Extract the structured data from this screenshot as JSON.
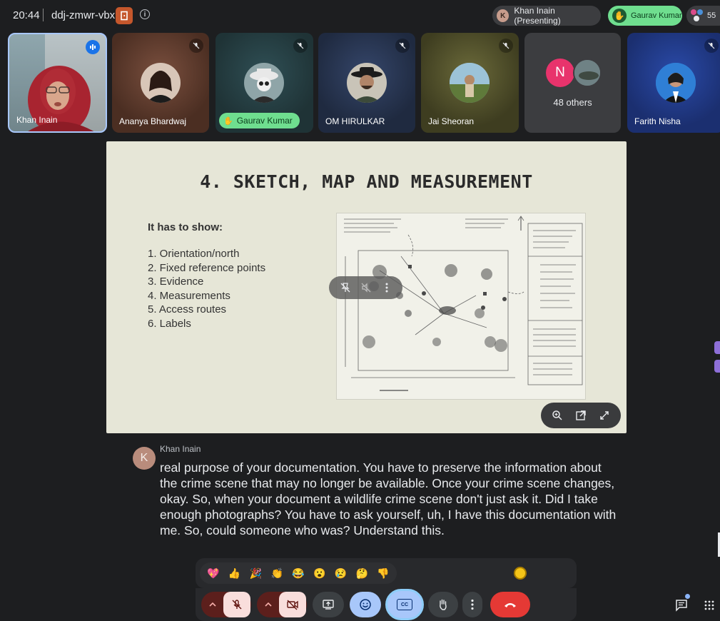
{
  "header": {
    "time": "20:44",
    "meeting_code": "ddj-zmwr-vbx",
    "presenter_initial": "K",
    "presenter_label": "Khan Inain (Presenting)",
    "hand_raised_name": "Gaurav Kumar",
    "participant_count": "55"
  },
  "tiles": [
    {
      "name": "Khan Inain"
    },
    {
      "name": "Ananya Bhardwaj"
    },
    {
      "name": "Gaurav Kumar"
    },
    {
      "name": "OM HIRULKAR"
    },
    {
      "name": "Jai Sheoran"
    },
    {
      "name": "48 others",
      "initial": "N"
    },
    {
      "name": "Farith Nisha"
    }
  ],
  "slide": {
    "title": "4. SKETCH, MAP AND MEASUREMENT",
    "subtitle": "It has to show:",
    "items": [
      "1. Orientation/north",
      "2. Fixed reference points",
      "3. Evidence",
      "4. Measurements",
      "5. Access routes",
      "6. Labels"
    ]
  },
  "caption": {
    "speaker_initial": "K",
    "speaker": "Khan Inain",
    "text": "real purpose of your documentation. You have to preserve the information about the crime scene that may no longer be available. Once your crime scene changes, okay. So, when your document a wildlife crime scene don't just ask it. Did I take enough photographs? You have to ask yourself, uh, I have this documentation with me. So, could someone who was? Understand this."
  },
  "reactions": [
    "💖",
    "👍",
    "🎉",
    "👏",
    "😂",
    "😮",
    "😢",
    "🤔",
    "👎"
  ],
  "controls": {
    "cc_label": "CC"
  },
  "colors": {
    "background": "#1d1e20",
    "hand_pill": "#6fde8f",
    "end_call": "#e53935",
    "mic_off": "#f9dedc",
    "active_blue": "#8ab4f8",
    "door_button": "#c5572c"
  }
}
